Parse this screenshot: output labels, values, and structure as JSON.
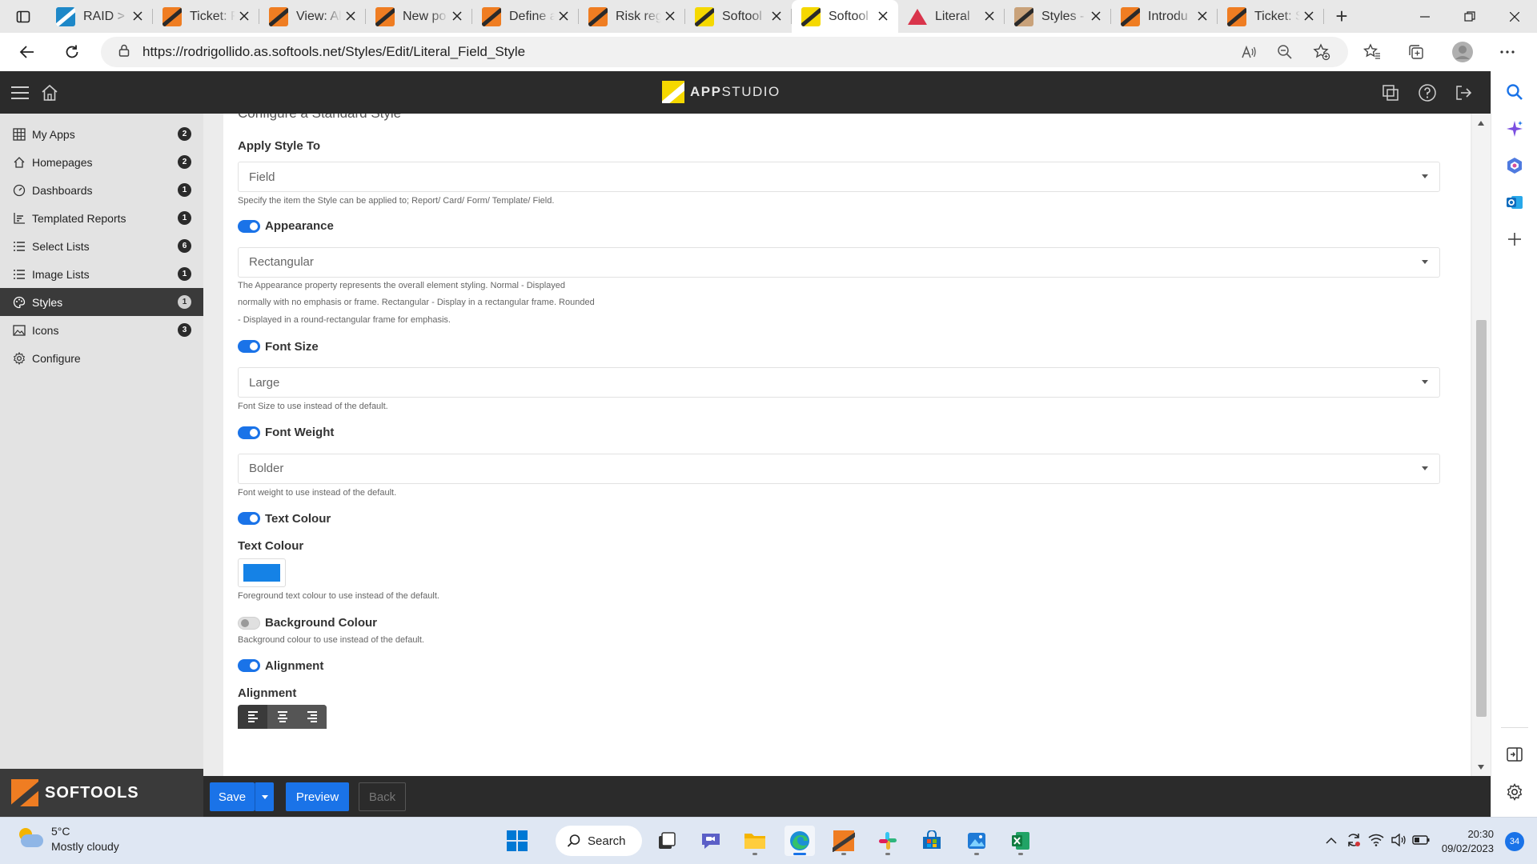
{
  "browser": {
    "tabs": [
      {
        "title": "RAID > ",
        "favicon": "blue"
      },
      {
        "title": "Ticket: F",
        "favicon": "orange"
      },
      {
        "title": "View: Al",
        "favicon": "orange"
      },
      {
        "title": "New po",
        "favicon": "orange"
      },
      {
        "title": "Define a",
        "favicon": "orange"
      },
      {
        "title": "Risk reg",
        "favicon": "orange"
      },
      {
        "title": "Softool",
        "favicon": "yellow"
      },
      {
        "title": "Softool",
        "favicon": "yellow",
        "active": true
      },
      {
        "title": "Literal",
        "favicon": "red"
      },
      {
        "title": "Styles -",
        "favicon": "tan"
      },
      {
        "title": "Introdu",
        "favicon": "orange"
      },
      {
        "title": "Ticket: S",
        "favicon": "orange"
      }
    ],
    "url": "https://rodrigollido.as.softools.net/Styles/Edit/Literal_Field_Style"
  },
  "app": {
    "logo_text_bold": "APP",
    "logo_text_thin": "STUDIO",
    "brand": "SOFTOOLS"
  },
  "sidebar": {
    "items": [
      {
        "label": "My Apps",
        "count": "2",
        "icon": "grid-icon"
      },
      {
        "label": "Homepages",
        "count": "2",
        "icon": "home-network-icon"
      },
      {
        "label": "Dashboards",
        "count": "1",
        "icon": "gauge-icon"
      },
      {
        "label": "Templated Reports",
        "count": "1",
        "icon": "chart-icon"
      },
      {
        "label": "Select Lists",
        "count": "6",
        "icon": "list-icon"
      },
      {
        "label": "Image Lists",
        "count": "1",
        "icon": "list-icon"
      },
      {
        "label": "Styles",
        "count": "1",
        "icon": "palette-icon",
        "active": true
      },
      {
        "label": "Icons",
        "count": "3",
        "icon": "image-icon"
      },
      {
        "label": "Configure",
        "count": "",
        "icon": "gear-icon"
      }
    ]
  },
  "form": {
    "heading": "Configure a Standard Style",
    "apply_style_to": {
      "label": "Apply Style To",
      "value": "Field",
      "help": "Specify the item the Style can be applied to; Report/ Card/ Form/ Template/ Field."
    },
    "appearance": {
      "label": "Appearance",
      "value": "Rectangular",
      "enabled": true,
      "help_lines": [
        "The Appearance property represents the overall element styling. Normal - Displayed",
        "normally with no emphasis or frame. Rectangular - Display in a rectangular frame. Rounded",
        "- Displayed in a round-rectangular frame for emphasis."
      ]
    },
    "font_size": {
      "label": "Font Size",
      "value": "Large",
      "enabled": true,
      "help": "Font Size to use instead of the default."
    },
    "font_weight": {
      "label": "Font Weight",
      "value": "Bolder",
      "enabled": true,
      "help": "Font weight to use instead of the default."
    },
    "text_colour": {
      "label": "Text Colour",
      "field_label": "Text Colour",
      "color": "#1582e6",
      "enabled": true,
      "help": "Foreground text colour to use instead of the default."
    },
    "background_colour": {
      "label": "Background Colour",
      "enabled": false,
      "help": "Background colour to use instead of the default."
    },
    "alignment": {
      "label": "Alignment",
      "field_label": "Alignment",
      "enabled": true,
      "selected": "left"
    }
  },
  "footer": {
    "save": "Save",
    "preview": "Preview",
    "back": "Back"
  },
  "taskbar": {
    "temperature": "5°C",
    "weather": "Mostly cloudy",
    "search": "Search",
    "time": "20:30",
    "date": "09/02/2023",
    "notifications": "34"
  },
  "colors": {
    "accent": "#1a73e8",
    "header_bg": "#2b2b2b",
    "sidebar_bg": "#e3e3e3"
  }
}
